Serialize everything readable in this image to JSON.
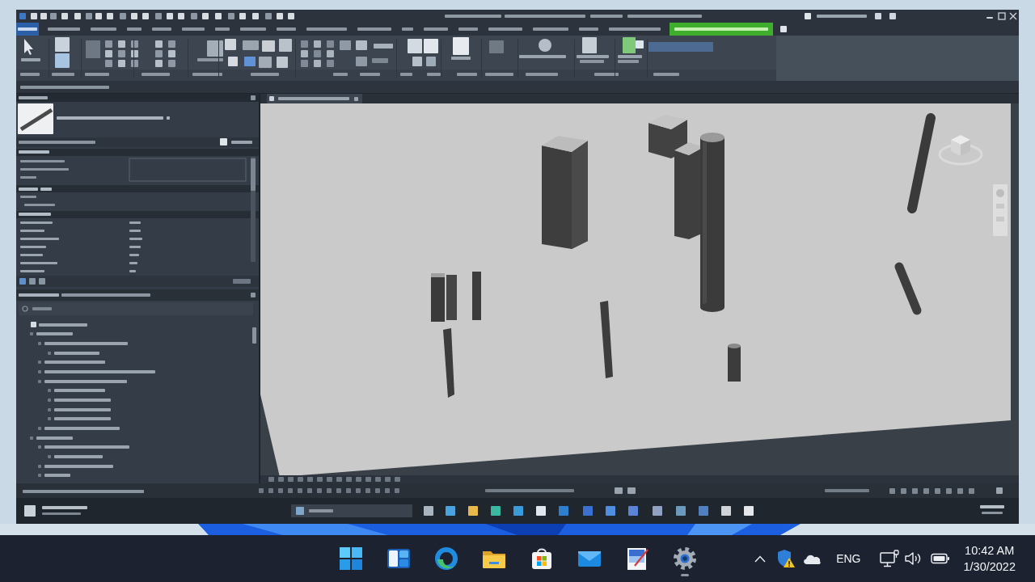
{
  "app_window": {
    "ribbon_tabs": [
      {
        "kind": "file",
        "selected": false
      },
      {
        "kind": "tab",
        "selected": false
      },
      {
        "kind": "tab",
        "selected": false
      },
      {
        "kind": "tab",
        "selected": false
      },
      {
        "kind": "tab",
        "selected": false
      },
      {
        "kind": "tab",
        "selected": false
      },
      {
        "kind": "tab",
        "selected": false
      },
      {
        "kind": "tab",
        "selected": false
      },
      {
        "kind": "tab",
        "selected": false
      },
      {
        "kind": "tab",
        "selected": false
      },
      {
        "kind": "tab",
        "selected": false
      },
      {
        "kind": "tab",
        "selected": false
      },
      {
        "kind": "tab",
        "selected": false
      },
      {
        "kind": "tab",
        "selected": false
      },
      {
        "kind": "tab",
        "selected": false
      },
      {
        "kind": "tab",
        "selected": false
      },
      {
        "kind": "tab",
        "selected": false
      },
      {
        "kind": "tab",
        "selected": false
      },
      {
        "kind": "tab",
        "selected": true
      }
    ]
  },
  "taskbar": {
    "apps": [
      {
        "kind": "start",
        "running": false
      },
      {
        "kind": "widgets",
        "running": false
      },
      {
        "kind": "browser",
        "running": false
      },
      {
        "kind": "folder",
        "running": false
      },
      {
        "kind": "store",
        "running": false
      },
      {
        "kind": "mail",
        "running": false
      },
      {
        "kind": "paint",
        "running": false
      },
      {
        "kind": "settings",
        "running": true
      }
    ],
    "language": "ENG",
    "time": "10:42 AM",
    "date": "1/30/2022"
  }
}
